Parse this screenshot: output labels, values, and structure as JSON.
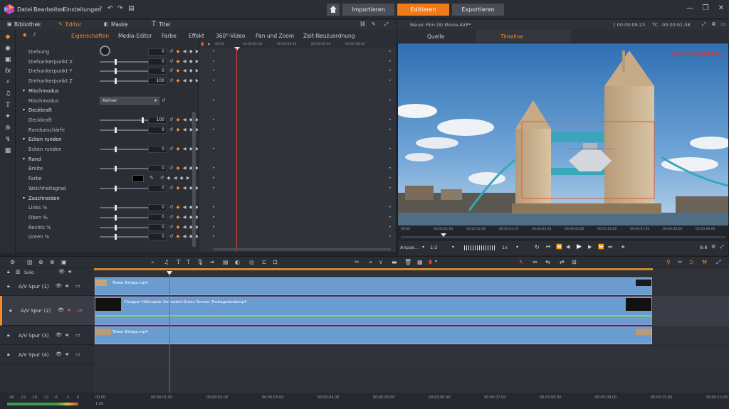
{
  "menu": {
    "items": [
      "Datei",
      "Bearbeiten",
      "Einstellungen"
    ]
  },
  "nav": {
    "import": "Importieren",
    "edit": "Editieren",
    "export": "Exportieren"
  },
  "tabs": {
    "bibliothek": "Bibliothek",
    "editor": "Editor",
    "maske": "Maske",
    "titel": "Titel"
  },
  "project": {
    "title": "Neuer Film (8).Movie.AXP*",
    "time1": "[ 00:00:09.23",
    "tc_label": "TC",
    "time2": "00:00:01.08"
  },
  "subtabs": [
    "Eigenschaften",
    "Media-Editor",
    "Farbe",
    "Effekt",
    "360°-Video",
    "Pan und Zoom",
    "Zeit-Neuzuordnung"
  ],
  "properties": {
    "rows": [
      {
        "type": "row",
        "label": "Drehung",
        "value": "0",
        "dial": true
      },
      {
        "type": "row",
        "label": "Drehankerpunkt X",
        "value": "0"
      },
      {
        "type": "row",
        "label": "Drehankerpunkt Y",
        "value": "0"
      },
      {
        "type": "row",
        "label": "Drehankerpunkt Z",
        "value": "100"
      },
      {
        "type": "section",
        "label": "Mischmodus"
      },
      {
        "type": "select",
        "label": "Mischmodus",
        "value": "Keiner"
      },
      {
        "type": "section",
        "label": "Deckkraft"
      },
      {
        "type": "row",
        "label": "Deckkraft",
        "value": "100",
        "knob": 0.9
      },
      {
        "type": "row",
        "label": "Randunschärfe",
        "value": "0"
      },
      {
        "type": "section",
        "label": "Ecken runden"
      },
      {
        "type": "row",
        "label": "Ecken runden",
        "value": "0"
      },
      {
        "type": "section",
        "label": "Rand"
      },
      {
        "type": "row",
        "label": "Breite",
        "value": "0"
      },
      {
        "type": "color",
        "label": "Farbe"
      },
      {
        "type": "row",
        "label": "Weichheitsgrad",
        "value": "0"
      },
      {
        "type": "section",
        "label": "Zuschneiden"
      },
      {
        "type": "row",
        "label": "Links %",
        "value": "0"
      },
      {
        "type": "row",
        "label": "Oben %",
        "value": "0"
      },
      {
        "type": "row",
        "label": "Rechts %",
        "value": "0"
      },
      {
        "type": "row",
        "label": "Unten %",
        "value": "0"
      }
    ]
  },
  "kf_ruler": [
    "00:00",
    "00:00:02.00",
    "00:00:04.00",
    "00:00:06.00",
    "00:00:08.00"
  ],
  "preview": {
    "source_tab": "Quelle",
    "timeline_tab": "Timeline",
    "overlay_text": "Geschwindigkeit 1x",
    "ruler": [
      "00:00",
      "00:00:01.00",
      "00:00:02.00",
      "00:00:03.00",
      "00:00:04.00",
      "00:00:05.00",
      "00:00:06.00",
      "00:00:07.00",
      "00:00:08.00",
      "00:00:09.00"
    ],
    "fit": "Anpas...",
    "ratio": "1/2",
    "speed": "1x",
    "zoom": "8:8"
  },
  "tracks": {
    "solo": "Solo",
    "rows": [
      {
        "label": "A/V Spur (1)",
        "clip": "Tower Bridge.mp4"
      },
      {
        "label": "A/V Spur (2)",
        "clip": "Chopper Helicopter Animated Green Screen_Footagelandsmp4"
      },
      {
        "label": "A/V Spur (3)",
        "clip": "Tower Bridge.mp4"
      },
      {
        "label": "A/V Spur (4)",
        "clip": ""
      }
    ]
  },
  "bottom_ruler": [
    "00.00",
    "00:00:01.00",
    "00:00:02.00",
    "00:00:03.00",
    "00:00:04.00",
    "00:00:05.00",
    "00:00:06.00",
    "00:00:07.00",
    "00:00:08.00",
    "00:00:09.00",
    "00:00:10.00",
    "00:00:11.00"
  ],
  "meter_scale": [
    "-60",
    "-22",
    "-16",
    "-12",
    "-6",
    "-3",
    "0"
  ],
  "bottom_time": "1.00"
}
